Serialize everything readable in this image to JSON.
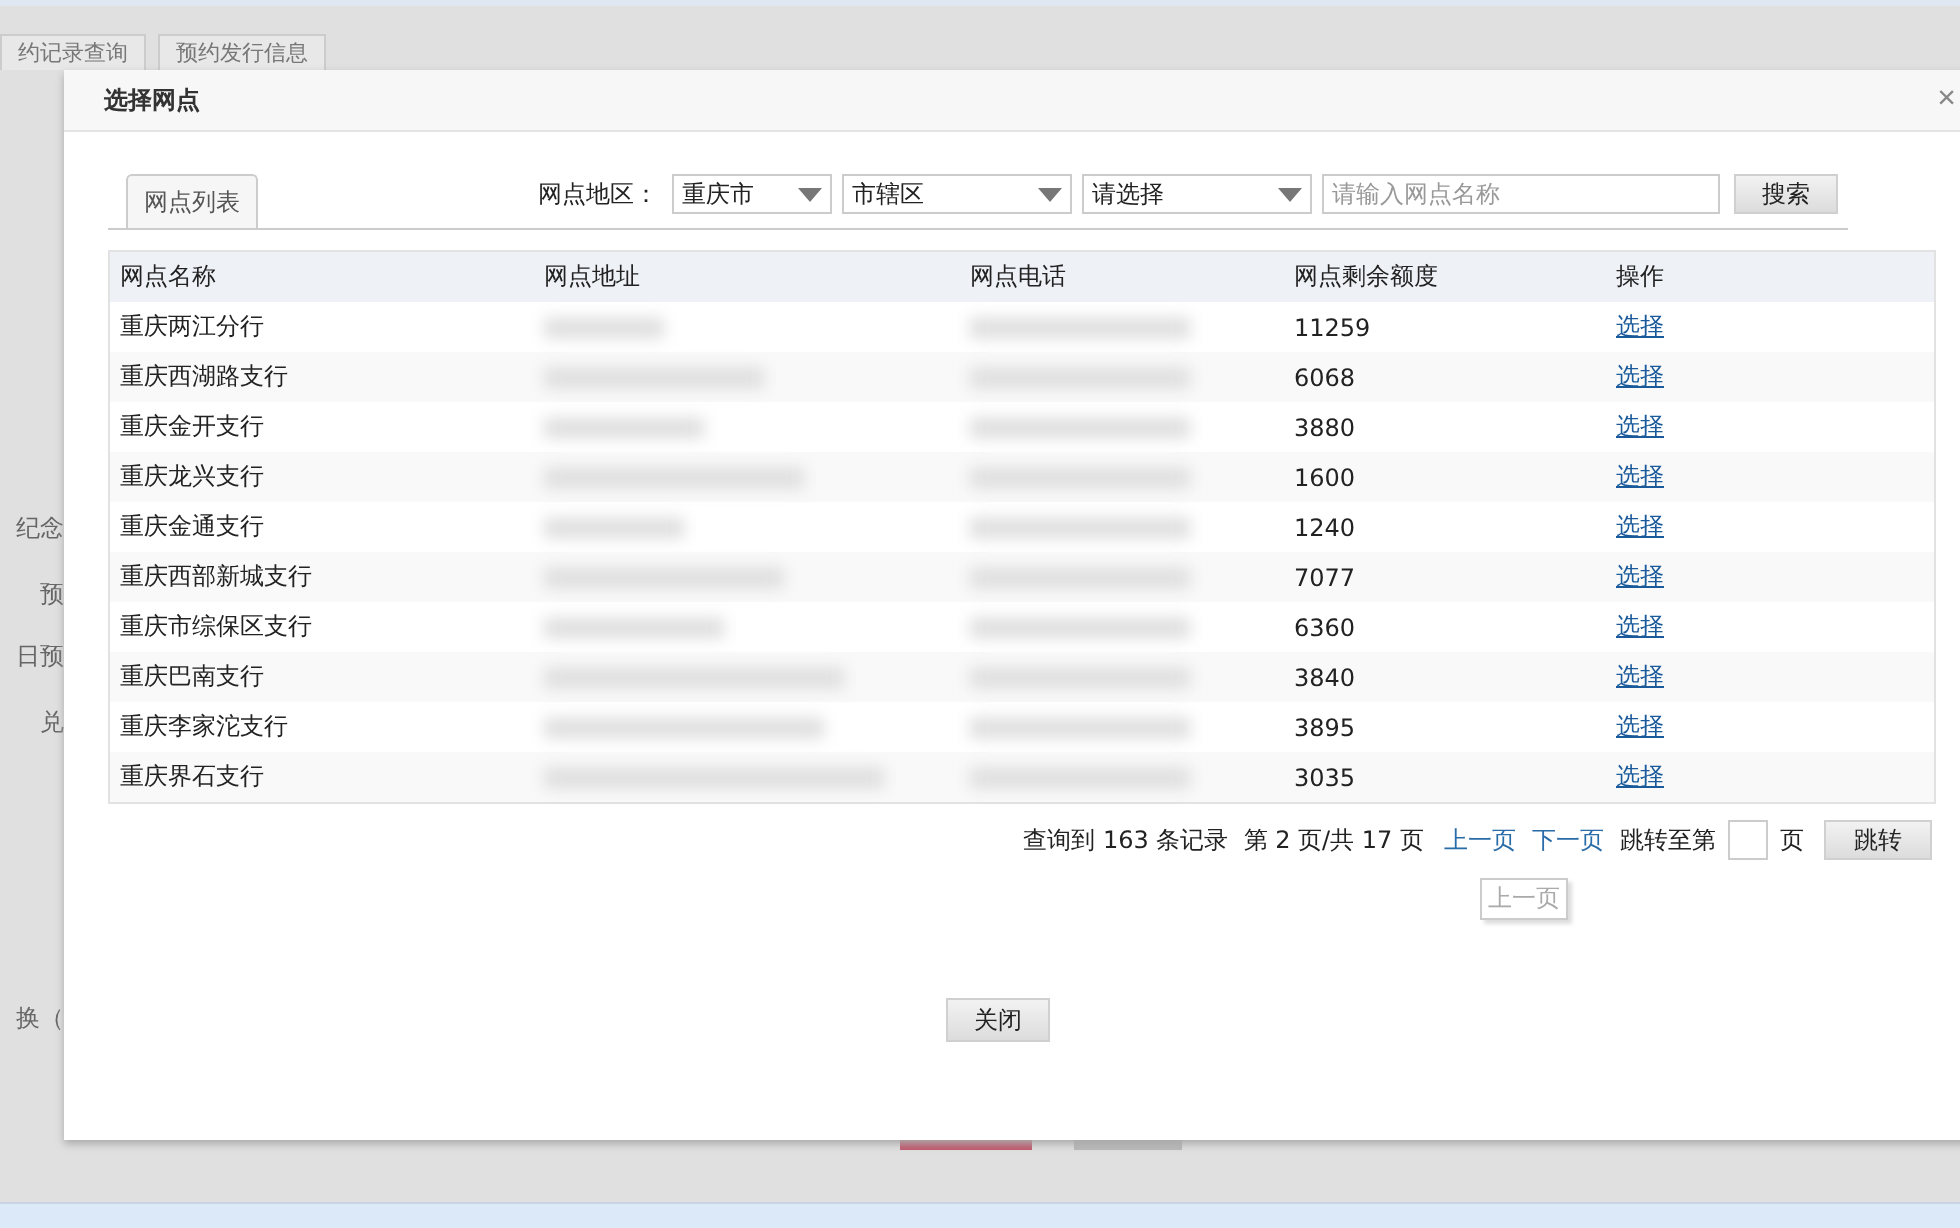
{
  "background": {
    "tabs": [
      {
        "label": "约记录查询"
      },
      {
        "label": "预约发行信息"
      }
    ],
    "labels": [
      "纪念",
      "预",
      "日预",
      "兑",
      "换（"
    ]
  },
  "dialog": {
    "title": "选择网点",
    "close": "×",
    "tabs": [
      {
        "label": "网点列表",
        "selected": true
      }
    ],
    "filter": {
      "label": "网点地区：",
      "selects": [
        "重庆市",
        "市辖区",
        "请选择"
      ],
      "search_placeholder": "请输入网点名称",
      "search_button": "搜索"
    },
    "table": {
      "columns": [
        "网点名称",
        "网点地址",
        "网点电话",
        "网点剩余额度",
        "操作"
      ],
      "rows": [
        {
          "name": "重庆两江分行",
          "quota": "11259",
          "action": "选择"
        },
        {
          "name": "重庆西湖路支行",
          "quota": "6068",
          "action": "选择"
        },
        {
          "name": "重庆金开支行",
          "quota": "3880",
          "action": "选择"
        },
        {
          "name": "重庆龙兴支行",
          "quota": "1600",
          "action": "选择"
        },
        {
          "name": "重庆金通支行",
          "quota": "1240",
          "action": "选择"
        },
        {
          "name": "重庆西部新城支行",
          "quota": "7077",
          "action": "选择"
        },
        {
          "name": "重庆市综保区支行",
          "quota": "6360",
          "action": "选择"
        },
        {
          "name": "重庆巴南支行",
          "quota": "3840",
          "action": "选择"
        },
        {
          "name": "重庆李家沱支行",
          "quota": "3895",
          "action": "选择"
        },
        {
          "name": "重庆界石支行",
          "quota": "3035",
          "action": "选择"
        }
      ]
    },
    "pagination": {
      "summary": "查询到 163 条记录  第 2 页/共 17 页",
      "prev": "上一页",
      "next": "下一页",
      "jump_label": "跳转至第",
      "jump_suffix": "页",
      "jump_button": "跳转",
      "tooltip": "上一页"
    },
    "close_button": "关闭"
  }
}
